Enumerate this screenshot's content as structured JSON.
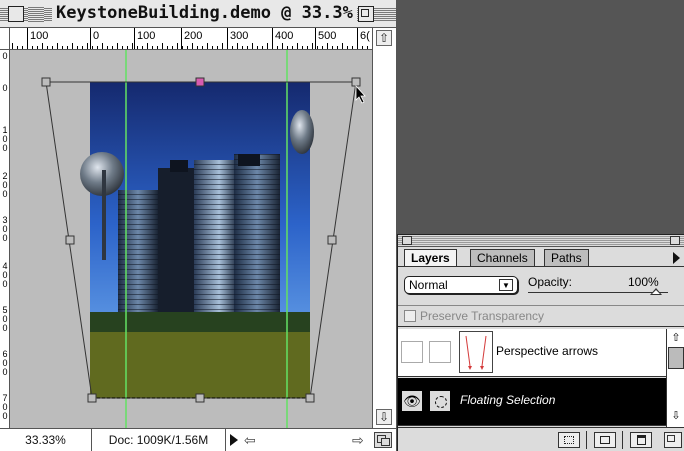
{
  "document": {
    "title": "KeystoneBuilding.demo @ 33.3%",
    "ruler_h_labels": [
      "100",
      "0",
      "100",
      "200",
      "300",
      "400",
      "500",
      "6("
    ],
    "ruler_v_labels": [
      "0",
      "0",
      "1\n0\n0",
      "2\n0\n0",
      "3\n0\n0",
      "4\n0\n0",
      "5\n0\n0",
      "6\n0\n0",
      "7\n0\n0"
    ],
    "status": {
      "zoom": "33.33%",
      "doc_info": "Doc: 1009K/1.56M"
    }
  },
  "icons": {
    "close_box": "close-box",
    "zoom_box": "zoom-box",
    "scroll_up": "up-arrow",
    "scroll_down": "down-arrow",
    "scroll_left": "left-arrow",
    "scroll_right": "right-arrow",
    "grow_box": "size-box",
    "eye": "eye-icon",
    "selection": "marquee-icon",
    "mask": "mask-icon",
    "new_layer": "new-layer-icon",
    "trash": "trash-icon"
  },
  "layers_palette": {
    "tabs": [
      "Layers",
      "Channels",
      "Paths"
    ],
    "active_tab": "Layers",
    "blend_mode": "Normal",
    "opacity_label": "Opacity:",
    "opacity_value": "100%",
    "opacity_fraction": 1.0,
    "preserve_transparency": "Preserve Transparency",
    "layers": [
      {
        "name": "Perspective arrows",
        "selected": false
      },
      {
        "name": "Floating Selection",
        "selected": true
      }
    ]
  },
  "colors": {
    "guide": "#63e163",
    "sky_top": "#15296e",
    "sky_bottom": "#5fa5f2",
    "handle_marker": "#d85cb0"
  }
}
